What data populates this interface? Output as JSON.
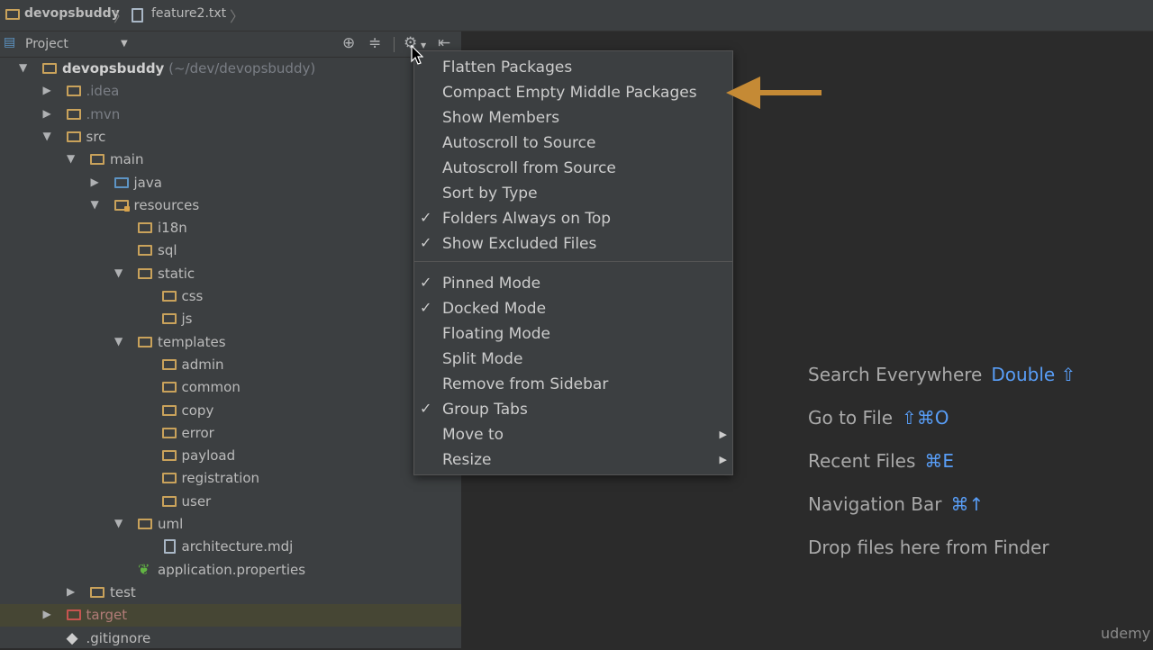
{
  "breadcrumb": {
    "project": "devopsbuddy",
    "file": "feature2.txt",
    "separator": "〉"
  },
  "project_panel": {
    "title": "Project"
  },
  "tree": [
    {
      "label": "devopsbuddy",
      "hint": "(~/dev/devopsbuddy)",
      "icon": "module-folder-icon",
      "expanded": true
    },
    {
      "label": ".idea",
      "icon": "folder-icon",
      "expanded": false
    },
    {
      "label": ".mvn",
      "icon": "folder-icon",
      "expanded": false
    },
    {
      "label": "src",
      "icon": "folder-icon",
      "expanded": true
    },
    {
      "label": "main",
      "icon": "folder-icon",
      "expanded": true
    },
    {
      "label": "java",
      "icon": "source-folder-icon",
      "expanded": false
    },
    {
      "label": "resources",
      "icon": "resources-folder-icon",
      "expanded": true
    },
    {
      "label": "i18n",
      "icon": "folder-icon"
    },
    {
      "label": "sql",
      "icon": "folder-icon"
    },
    {
      "label": "static",
      "icon": "folder-icon",
      "expanded": true
    },
    {
      "label": "css",
      "icon": "folder-icon"
    },
    {
      "label": "js",
      "icon": "folder-icon"
    },
    {
      "label": "templates",
      "icon": "folder-icon",
      "expanded": true
    },
    {
      "label": "admin",
      "icon": "folder-icon"
    },
    {
      "label": "common",
      "icon": "folder-icon"
    },
    {
      "label": "copy",
      "icon": "folder-icon"
    },
    {
      "label": "error",
      "icon": "folder-icon"
    },
    {
      "label": "payload",
      "icon": "folder-icon"
    },
    {
      "label": "registration",
      "icon": "folder-icon"
    },
    {
      "label": "user",
      "icon": "folder-icon"
    },
    {
      "label": "uml",
      "icon": "folder-icon",
      "expanded": true
    },
    {
      "label": "architecture.mdj",
      "icon": "file-icon"
    },
    {
      "label": "application.properties",
      "icon": "spring-leaf-icon"
    },
    {
      "label": "test",
      "icon": "folder-icon",
      "expanded": false
    },
    {
      "label": "target",
      "icon": "excluded-folder-icon",
      "expanded": false,
      "selected": true
    },
    {
      "label": ".gitignore",
      "icon": "git-file-icon"
    }
  ],
  "menu": {
    "group1": [
      {
        "label": "Flatten Packages",
        "checked": false
      },
      {
        "label": "Compact Empty Middle Packages",
        "checked": false
      },
      {
        "label": "Show Members",
        "checked": false
      },
      {
        "label": "Autoscroll to Source",
        "checked": false
      },
      {
        "label": "Autoscroll from Source",
        "checked": false
      },
      {
        "label": "Sort by Type",
        "checked": false
      },
      {
        "label": "Folders Always on Top",
        "checked": true
      },
      {
        "label": "Show Excluded Files",
        "checked": true
      }
    ],
    "group2": [
      {
        "label": "Pinned Mode",
        "checked": true
      },
      {
        "label": "Docked Mode",
        "checked": true
      },
      {
        "label": "Floating Mode",
        "checked": false
      },
      {
        "label": "Split Mode",
        "checked": false
      },
      {
        "label": "Remove from Sidebar",
        "checked": false
      },
      {
        "label": "Group Tabs",
        "checked": true
      },
      {
        "label": "Move to",
        "checked": false,
        "submenu": true
      },
      {
        "label": "Resize",
        "checked": false,
        "submenu": true
      }
    ]
  },
  "hints": [
    {
      "text": "Search Everywhere",
      "key": "Double ⇧"
    },
    {
      "text": "Go to File",
      "key": "⇧⌘O"
    },
    {
      "text": "Recent Files",
      "key": "⌘E"
    },
    {
      "text": "Navigation Bar",
      "key": "⌘↑"
    },
    {
      "text": "Drop files here from Finder",
      "key": ""
    }
  ],
  "watermark": "udemy",
  "colors": {
    "accent_key": "#589df6",
    "callout_arrow": "#c58a35",
    "folder": "#c9a25b",
    "source_folder": "#5d94c4",
    "excluded_folder": "#c75450"
  }
}
